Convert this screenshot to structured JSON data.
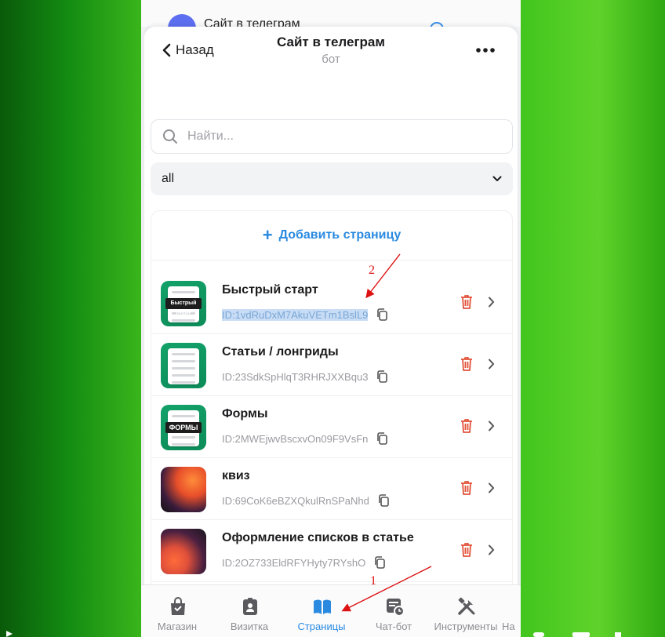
{
  "behind": {
    "title": "Сайт в телеграм"
  },
  "header": {
    "back_label": "Назад",
    "title": "Сайт в телеграм",
    "subtitle": "бот"
  },
  "search": {
    "placeholder": "Найти..."
  },
  "filter": {
    "selected": "all"
  },
  "add_page": {
    "label": "Добавить страницу"
  },
  "pages": [
    {
      "name": "Быстрый старт",
      "id": "ID:1vdRuDxM7AkuVETm1BslL9",
      "thumb": "green",
      "thumb_label": "Быстрый старт",
      "selected": true
    },
    {
      "name": "Статьи / лонгриды",
      "id": "ID:23SdkSpHlqT3RHRJXXBqu3",
      "thumb": "green",
      "thumb_label": "",
      "selected": false
    },
    {
      "name": "Формы",
      "id": "ID:2MWEjwvBscxvOn09F9VsFn",
      "thumb": "green",
      "thumb_label": "ФОРМЫ",
      "selected": false
    },
    {
      "name": "квиз",
      "id": "ID:69CoK6eBZXQkulRnSPaNhd",
      "thumb": "orange",
      "thumb_label": "",
      "selected": false
    },
    {
      "name": "Оформление списков в статье",
      "id": "ID:2OZ733EldRFYHyty7RYshO",
      "thumb": "orange2",
      "thumb_label": "",
      "selected": false
    }
  ],
  "tabs": [
    {
      "label": "Магазин",
      "icon": "shop-bag-icon",
      "active": false
    },
    {
      "label": "Визитка",
      "icon": "badge-icon",
      "active": false
    },
    {
      "label": "Страницы",
      "icon": "book-icon",
      "active": true
    },
    {
      "label": "Чат-бот",
      "icon": "chat-bot-icon",
      "active": false
    },
    {
      "label": "Инструменты",
      "icon": "tools-icon",
      "active": false
    },
    {
      "label": "На",
      "icon": "",
      "active": false
    }
  ],
  "annotations": {
    "one": "1",
    "two": "2"
  },
  "colors": {
    "accent": "#2a8ae0",
    "danger": "#e2533a",
    "annotation": "#dd1111",
    "background": "#41c51e"
  }
}
